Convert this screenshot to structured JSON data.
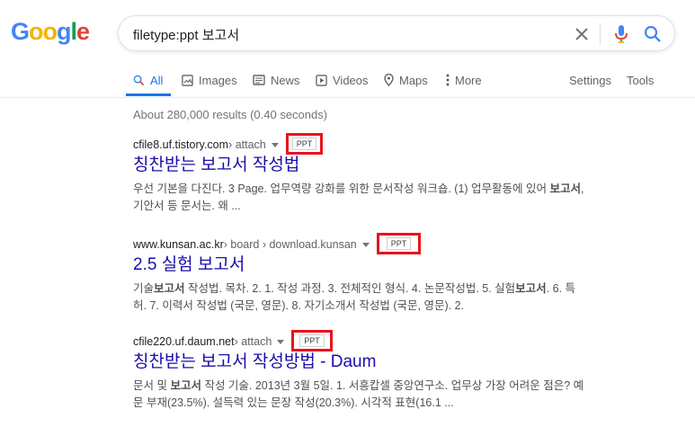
{
  "logo": {
    "letters": [
      "G",
      "o",
      "o",
      "g",
      "l",
      "e"
    ]
  },
  "search": {
    "query": "filetype:ppt 보고서"
  },
  "tabs": [
    {
      "label": "All",
      "icon": "search-icon"
    },
    {
      "label": "Images",
      "icon": "image-icon"
    },
    {
      "label": "News",
      "icon": "news-icon"
    },
    {
      "label": "Videos",
      "icon": "play-icon"
    },
    {
      "label": "Maps",
      "icon": "map-pin-icon"
    },
    {
      "label": "More",
      "icon": "more-dots-icon"
    }
  ],
  "tools": {
    "settings": "Settings",
    "tools": "Tools"
  },
  "stats": "About 280,000 results (0.40 seconds)",
  "results": [
    {
      "domain": "cfile8.uf.tistory.com",
      "path": " › attach",
      "badge": "PPT",
      "title": "칭찬받는 보고서 작성법",
      "snippet_line1_a": "우선 기본을 다진다. 3 Page. 업무역량 강화를 위한 문서작성 워크숍. (1) 업무활동에 있어 ",
      "snippet_line1_b": "보고서",
      "snippet_line1_c": ",",
      "snippet_line2": "기안서 등 문서는. 왜 ..."
    },
    {
      "domain": "www.kunsan.ac.kr",
      "path": " › board › download.kunsan",
      "badge": "PPT",
      "title": "2.5 실험 보고서",
      "snippet_line1_a": "기술",
      "snippet_line1_b": "보고서",
      "snippet_line1_c": " 작성법. 목차. 2. 1. 작성 과정. 3. 전체적인 형식. 4. 논문작성법. 5. 실험",
      "snippet_line1_d": "보고서",
      "snippet_line1_e": ". 6. 특",
      "snippet_line2": "허. 7. 이력서 작성법 (국문, 영문). 8. 자기소개서 작성법 (국문, 영문). 2."
    },
    {
      "domain": "cfile220.uf.daum.net",
      "path": " › attach",
      "badge": "PPT",
      "title": "칭찬받는 보고서 작성방법 - Daum",
      "snippet_line1_a": "문서 및 ",
      "snippet_line1_b": "보고서",
      "snippet_line1_c": " 작성 기술. 2013년 3월 5일. 1. 서흥캅셀 중앙연구소. 업무상 가장 어려운 점은? 예",
      "snippet_line2": "문 부재(23.5%). 설득력 있는 문장 작성(20.3%). 시각적 표현(16.1 ..."
    }
  ],
  "colors": {
    "accent": "#1a73e8",
    "link": "#1a0dab",
    "badge_highlight": "#e8141c"
  }
}
